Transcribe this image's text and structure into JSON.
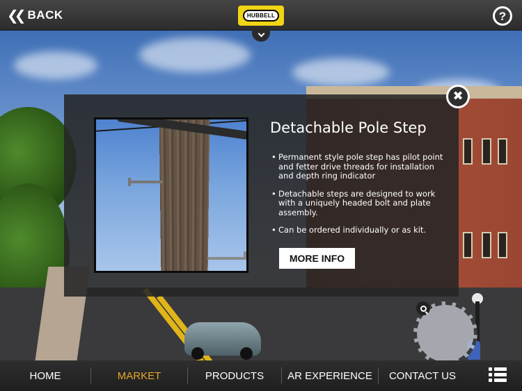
{
  "header": {
    "back_label": "BACK",
    "logo_text": "HUBBELL",
    "help_icon": "?"
  },
  "icons": {
    "back": "double-chevron-left-icon",
    "help": "question-circle-icon",
    "dropdown": "chevron-down-icon",
    "close": "close-circle-icon",
    "minimap_zoom": "search-icon",
    "menu": "list-menu-icon"
  },
  "modal": {
    "title": "Detachable Pole Step",
    "bullets": [
      "Permanent style pole step has pilot point and fetter drive threads for installation and depth ring indicator",
      "Detachable steps are designed to work with a uniquely headed bolt and plate assembly.",
      "Can be ordered individually or as kit."
    ],
    "more_info_label": "MORE INFO",
    "close_symbol": "✖"
  },
  "nav": {
    "items": [
      {
        "label": "HOME",
        "active": false
      },
      {
        "label": "MARKET",
        "active": true
      },
      {
        "label": "PRODUCTS",
        "active": false
      },
      {
        "label": "AR EXPERIENCE",
        "active": false
      },
      {
        "label": "CONTACT US",
        "active": false
      }
    ]
  },
  "colors": {
    "active_nav": "#e4a82a",
    "logo_yellow": "#f1d415",
    "bar_bg": "#2c2c2c"
  }
}
